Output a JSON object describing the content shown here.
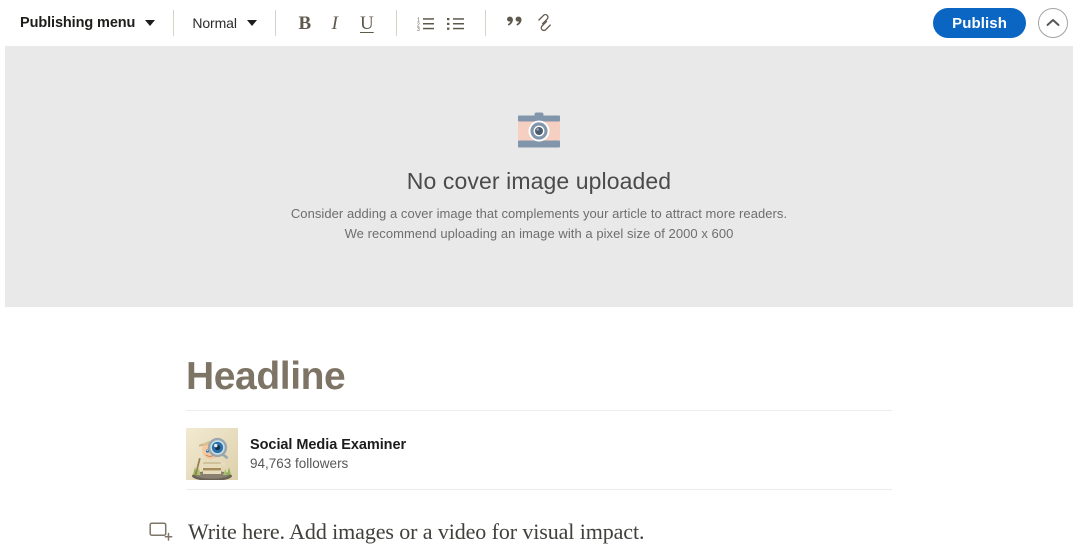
{
  "toolbar": {
    "publishing_menu": {
      "label": "Publishing menu",
      "caret_icon": "chevron-down-icon"
    },
    "style_select": {
      "value": "Normal",
      "caret_icon": "chevron-down-icon"
    },
    "format_buttons": [
      {
        "name": "bold",
        "glyph": "B",
        "icon": "bold-icon"
      },
      {
        "name": "italic",
        "glyph": "I",
        "icon": "italic-icon"
      },
      {
        "name": "underline",
        "glyph": "U",
        "icon": "underline-icon"
      },
      {
        "name": "ordered-list",
        "glyph": "",
        "icon": "ordered-list-icon"
      },
      {
        "name": "bulleted-list",
        "glyph": "",
        "icon": "bulleted-list-icon"
      },
      {
        "name": "blockquote",
        "glyph": "”",
        "icon": "quote-icon"
      },
      {
        "name": "link",
        "glyph": "",
        "icon": "link-icon"
      }
    ],
    "publish_label": "Publish",
    "collapse_icon": "chevron-up-icon"
  },
  "cover": {
    "icon": "camera-icon",
    "title": "No cover image uploaded",
    "subtitle_line1": "Consider adding a cover image that complements your article to attract more readers.",
    "subtitle_line2": "We recommend uploading an image with a pixel size of 2000 x 600"
  },
  "article": {
    "headline_placeholder": "Headline",
    "author": {
      "avatar_icon": "avatar",
      "name": "Social Media Examiner",
      "followers": "94,763 followers"
    },
    "body": {
      "add_block_icon": "add-block-icon",
      "placeholder": "Write here. Add images or a video for visual impact."
    }
  },
  "colors": {
    "publish_blue": "#0a66c2",
    "cover_background": "#e9e9e9",
    "headline_placeholder": "#7d7465",
    "toolbar_icon": "#5f584c",
    "camera_body": "#8196ab",
    "camera_band": "#f6cfc3"
  }
}
